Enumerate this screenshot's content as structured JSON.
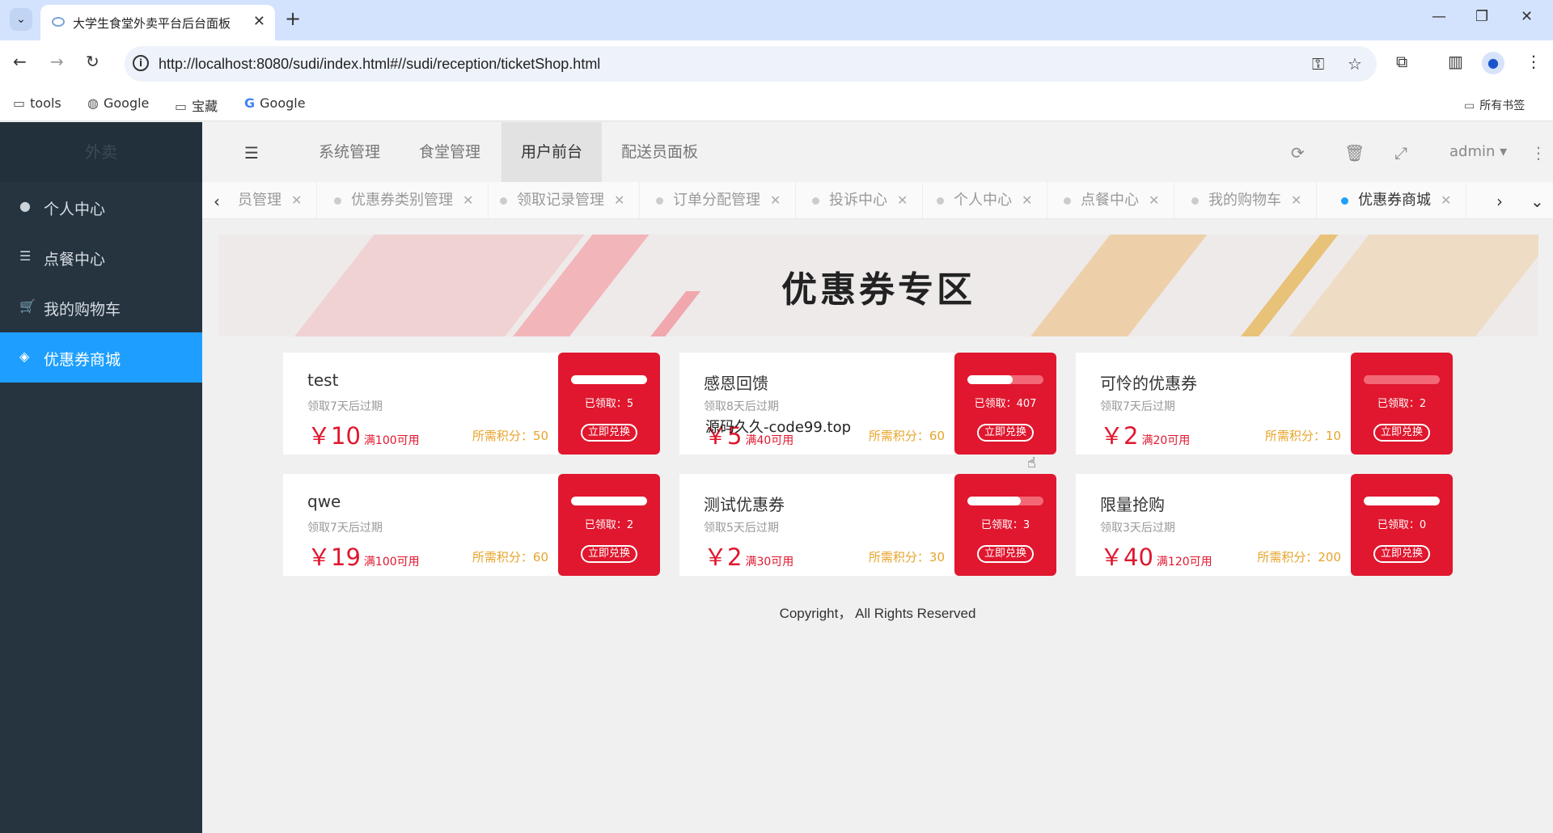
{
  "browser": {
    "tab_title": "大学生食堂外卖平台后台面板",
    "url": "http://localhost:8080/sudi/index.html#//sudi/reception/ticketShop.html",
    "bookmarks": [
      "tools",
      "Google",
      "宝藏",
      "Google"
    ],
    "all_bookmarks": "所有书签"
  },
  "sidebar": {
    "logo": "外卖",
    "items": [
      {
        "label": "个人中心",
        "icon": "user-icon"
      },
      {
        "label": "点餐中心",
        "icon": "list-icon"
      },
      {
        "label": "我的购物车",
        "icon": "cart-icon"
      },
      {
        "label": "优惠券商城",
        "icon": "tag-icon",
        "active": true
      }
    ]
  },
  "topnav": {
    "items": [
      "系统管理",
      "食堂管理",
      "用户前台",
      "配送员面板"
    ],
    "active": "用户前台",
    "user": "admin"
  },
  "pagetabs": [
    "员管理",
    "优惠券类别管理",
    "领取记录管理",
    "订单分配管理",
    "投诉中心",
    "个人中心",
    "点餐中心",
    "我的购物车",
    "优惠券商城"
  ],
  "banner": {
    "title": "优惠券专区"
  },
  "coupons": [
    {
      "name": "test",
      "expiry": "领取7天后过期",
      "price": "￥10",
      "condition": "满100可用",
      "points": "所需积分：50",
      "claimed": "已领取：5",
      "fill": 1.0,
      "button": "立即兑换"
    },
    {
      "name": "感恩回馈",
      "expiry": "领取8天后过期",
      "price": "￥5",
      "condition": "满40可用",
      "points": "所需积分：60",
      "claimed": "已领取：407",
      "fill": 0.6,
      "button": "立即兑换"
    },
    {
      "name": "可怜的优惠券",
      "expiry": "领取7天后过期",
      "price": "￥2",
      "condition": "满20可用",
      "points": "所需积分：10",
      "claimed": "已领取：2",
      "fill": 0.0,
      "button": "立即兑换"
    },
    {
      "name": "qwe",
      "expiry": "领取7天后过期",
      "price": "￥19",
      "condition": "满100可用",
      "points": "所需积分：60",
      "claimed": "已领取：2",
      "fill": 1.0,
      "button": "立即兑换"
    },
    {
      "name": "测试优惠券",
      "expiry": "领取5天后过期",
      "price": "￥2",
      "condition": "满30可用",
      "points": "所需积分：30",
      "claimed": "已领取：3",
      "fill": 0.7,
      "button": "立即兑换"
    },
    {
      "name": "限量抢购",
      "expiry": "领取3天后过期",
      "price": "￥40",
      "condition": "满120可用",
      "points": "所需积分：200",
      "claimed": "已领取：0",
      "fill": 1.0,
      "button": "立即兑换"
    }
  ],
  "copyright": "Copyright， All Rights Reserved",
  "overlay_note": "源码久久-code99.top",
  "colors": {
    "accent": "#1e9fff",
    "coupon_red": "#e0172e",
    "points": "#e7a42b",
    "sidebar": "#263440"
  }
}
